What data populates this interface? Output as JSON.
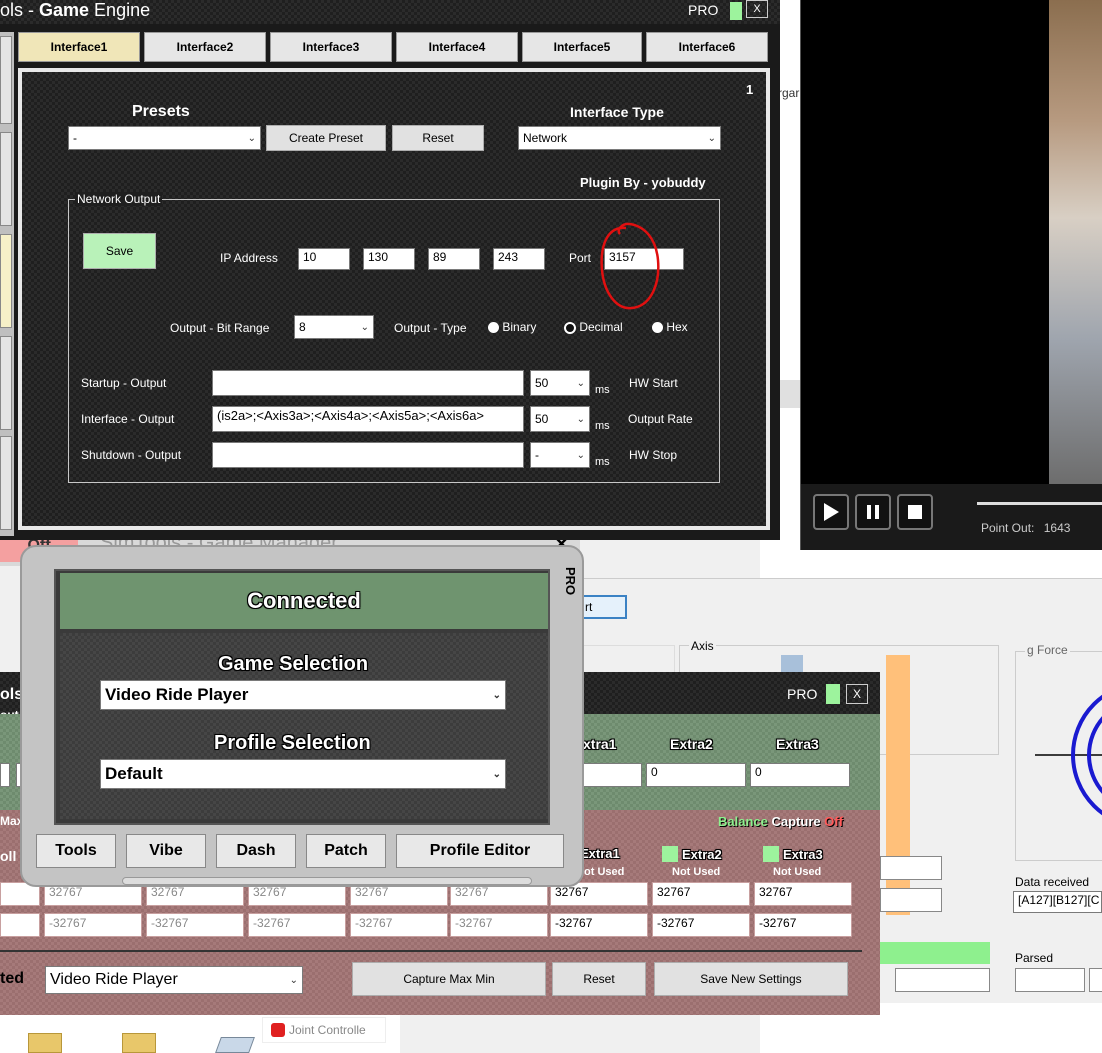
{
  "game_engine": {
    "title_prefix": "ols - ",
    "title_bold": "Game",
    "title_rest": " Engine",
    "pro_label": "PRO",
    "close_label": "X",
    "tabs": [
      "Interface1",
      "Interface2",
      "Interface3",
      "Interface4",
      "Interface5",
      "Interface6"
    ],
    "panel_number": "1",
    "presets_label": "Presets",
    "preset_value": "-",
    "create_preset_label": "Create Preset",
    "reset_label": "Reset",
    "interface_type_label": "Interface Type",
    "interface_type_value": "Network",
    "plugin_by": "Plugin By - yobuddy",
    "network_output_label": "Network Output",
    "save_label": "Save",
    "ip_label": "IP Address",
    "ip": [
      "10",
      "130",
      "89",
      "243"
    ],
    "port_label": "Port",
    "port_value": "3157",
    "bit_range_label": "Output - Bit Range",
    "bit_range_value": "8",
    "output_type_label": "Output - Type",
    "binary_label": "Binary",
    "decimal_label": "Decimal",
    "hex_label": "Hex",
    "startup_label": "Startup - Output",
    "startup_value": "",
    "startup_ms": "50",
    "ms_label": "ms",
    "hw_start_label": "HW Start",
    "interface_output_label": "Interface - Output",
    "interface_output_value": "(is2a>;<Axis3a>;<Axis4a>;<Axis5a>;<Axis6a>",
    "interface_ms": "50",
    "output_rate_label": "Output Rate",
    "shutdown_label": "Shutdown - Output",
    "shutdown_value": "",
    "shutdown_ms": "-",
    "hw_stop_label": "HW Stop"
  },
  "video_player": {
    "point_out_label": "Point Out:",
    "point_out_value": "1643"
  },
  "game_manager": {
    "title": "SimTools - Game Manager",
    "off_label": "Off",
    "pro_vertical": "PRO",
    "connected_label": "Connected",
    "game_selection_label": "Game Selection",
    "game_value": "Video Ride Player",
    "profile_selection_label": "Profile Selection",
    "profile_value": "Default",
    "buttons": [
      "Tools",
      "Vibe",
      "Dash",
      "Patch",
      "Profile Editor"
    ]
  },
  "axis_window": {
    "pro_label": "PRO",
    "close_label": "X",
    "left_fragment_1": "ols",
    "left_fragment_2": "out",
    "left_fragment_3": "Max",
    "left_fragment_4": "oll",
    "extra_headers": [
      "xtra1",
      "Extra2",
      "Extra3"
    ],
    "extra_values": [
      "0",
      "0"
    ],
    "balance_label": "Balance",
    "capture_label": "Capture",
    "off_label": "Off",
    "extra_toggles": [
      "Extra1",
      "Extra2",
      "Extra3"
    ],
    "not_used": [
      "ot Used",
      "Not Used",
      "Not Used"
    ],
    "max_row": [
      "32767",
      "32767",
      "32767",
      "32767",
      "32767",
      "32767",
      "32767",
      "32767"
    ],
    "min_row": [
      "-32767",
      "-32767",
      "-32767",
      "-32767",
      "-32767",
      "-32767",
      "-32767",
      "-32767"
    ],
    "bottom_left_fragment": "ted",
    "game_value": "Video Ride Player",
    "capture_max_min_label": "Capture Max Min",
    "reset_label": "Reset",
    "save_settings_label": "Save New Settings"
  },
  "controller_window": {
    "start_fragment": "rt",
    "axis_label": "Axis",
    "g_force_label": "g Force",
    "data_received_label": "Data received",
    "data_received_value": "[A127][B127][C",
    "parsed_label": "Parsed"
  },
  "background": {
    "organize_fragment": "rgar"
  },
  "taskbar": {
    "item_label": "Joint Controlle"
  }
}
